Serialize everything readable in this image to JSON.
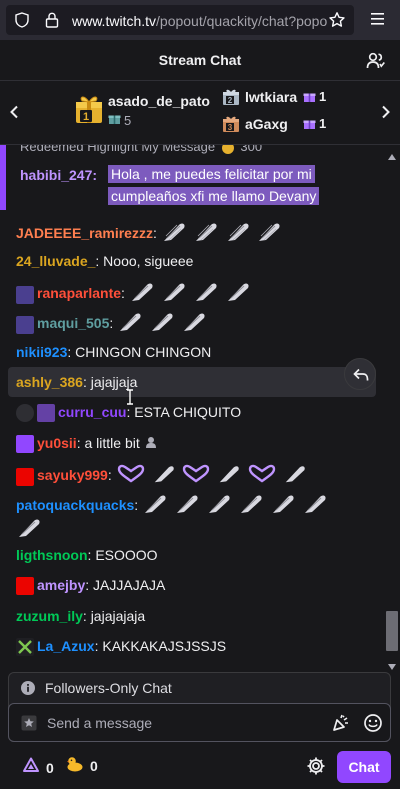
{
  "browser": {
    "url_host": "www.twitch.tv",
    "url_rest": "/popout/quackity/chat?popo"
  },
  "header": {
    "title": "Stream Chat"
  },
  "leaderboard": {
    "first": {
      "name": "asado_de_pato",
      "count": "5",
      "rank": "1"
    },
    "others": [
      {
        "rank": "2",
        "name": "lwtkiara",
        "count": "1"
      },
      {
        "rank": "3",
        "name": "aGaxg",
        "count": "1"
      }
    ]
  },
  "highlight": {
    "redeemed_text": "Redeemed Highlight My Message",
    "redeemed_cost": "300",
    "user": "habibi_247",
    "text": "Hola , me puedes felicitar por mi cumpleaños xfi me llamo Devany"
  },
  "messages": [
    {
      "user": "JADEEEE_ramirezzz",
      "color": "#ff7f50",
      "text": "",
      "emotes": 4
    },
    {
      "user": "24_lluvade_",
      "color": "#daa520",
      "text": "Nooo, sigueee"
    },
    {
      "user": "ranaparlante",
      "color": "#ff4f3a",
      "text": "",
      "emotes": 4
    },
    {
      "user": "maqui_505",
      "color": "#5f9ea0",
      "text": "",
      "emotes": 3
    },
    {
      "user": "nikii923",
      "color": "#1e90ff",
      "text": "CHINGON CHINGON"
    },
    {
      "user": "ashly_386",
      "color": "#daa520",
      "text": "jajajjaja"
    },
    {
      "user": "curru_cuu",
      "color": "#9147ff",
      "text": "ESTA CHIQUITO"
    },
    {
      "user": "yu0sii",
      "color": "#ff4f3a",
      "text": "a little bit"
    },
    {
      "user": "sayuky999",
      "color": "#ff4f3a",
      "text": ""
    },
    {
      "user": "patoquackquacks",
      "color": "#1e90ff",
      "text": ""
    },
    {
      "user": "ligthsnoon",
      "color": "#00ff7f",
      "text": "ESOOOO"
    },
    {
      "user": "amejby",
      "color": "#bf94ff",
      "text": "JAJJAJAJA"
    },
    {
      "user": "zuzum_ily",
      "color": "#00ff7f",
      "text": "jajajajaja"
    },
    {
      "user": "La_Azux",
      "color": "#1e90ff",
      "text": "KAKKAKAJSJSSJS"
    }
  ],
  "chat_input": {
    "followers_only": "Followers-Only Chat",
    "placeholder": "Send a message"
  },
  "bottom": {
    "points": "0",
    "duck_points": "0",
    "chat_button": "Chat"
  },
  "colors": {
    "accent": "#9147ff",
    "background": "#18181b"
  }
}
